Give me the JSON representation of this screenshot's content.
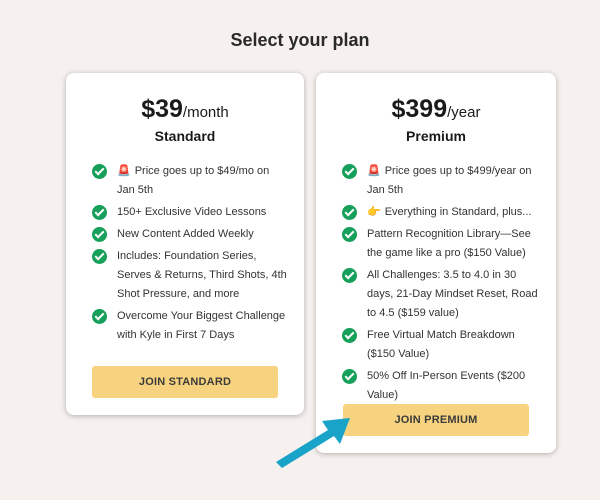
{
  "page": {
    "title": "Select your plan"
  },
  "plans": [
    {
      "price": "$39",
      "period": "/month",
      "name": "Standard",
      "features": [
        {
          "icon": "siren-icon",
          "text": "Price goes up to $49/mo on Jan 5th"
        },
        {
          "text": "150+ Exclusive Video Lessons"
        },
        {
          "text": "New Content Added Weekly"
        },
        {
          "text": "Includes: Foundation Series, Serves & Returns, Third Shots, 4th Shot Pressure, and more"
        },
        {
          "text": "Overcome Your Biggest Challenge with Kyle in First 7 Days"
        }
      ],
      "cta": "JOIN STANDARD"
    },
    {
      "price": "$399",
      "period": "/year",
      "name": "Premium",
      "features": [
        {
          "icon": "siren-icon",
          "text": "Price goes up to $499/year on Jan 5th"
        },
        {
          "icon": "pointing-hand-icon",
          "text": "Everything in Standard, plus..."
        },
        {
          "text": "Pattern Recognition Library—See the game like a pro ($150 Value)"
        },
        {
          "text": "All Challenges: 3.5 to 4.0 in 30 days, 21-Day Mindset Reset, Road to 4.5 ($159 value)"
        },
        {
          "text": "Free Virtual Match Breakdown ($150 Value)"
        },
        {
          "text": "50% Off In-Person Events ($200 Value)"
        }
      ],
      "cta": "JOIN PREMIUM"
    }
  ],
  "colors": {
    "background": "#f6f1ef",
    "check": "#17a05a",
    "cta": "#f7d37f",
    "arrow": "#1aa3c8"
  },
  "decorations": {
    "arrow_icon": "pointer-arrow-icon"
  }
}
